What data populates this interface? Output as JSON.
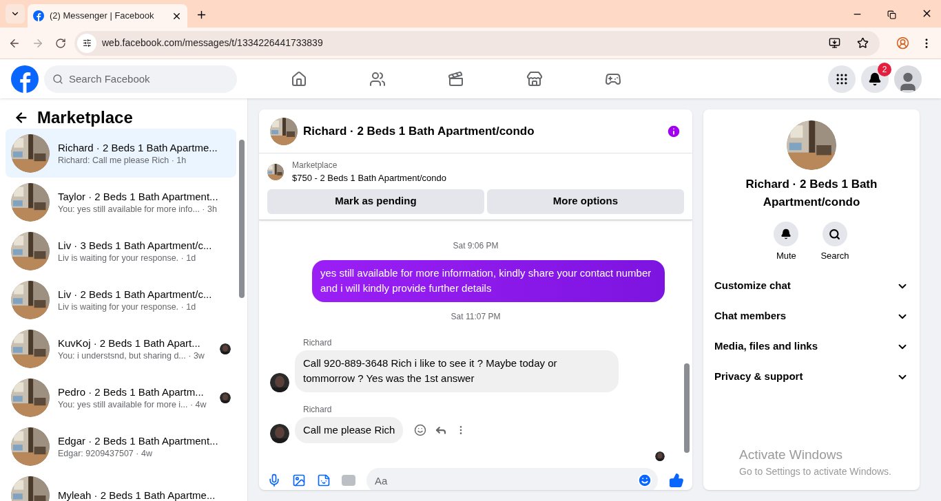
{
  "browser": {
    "tab_title": "(2) Messenger | Facebook",
    "url": "web.facebook.com/messages/t/1334226441733839"
  },
  "header": {
    "search_placeholder": "Search Facebook",
    "notification_count": "2"
  },
  "sidebar": {
    "title": "Marketplace",
    "conversations": [
      {
        "title": "Richard · 2 Beds 1 Bath Apartme...",
        "preview": "Richard: Call me please Rich · 1h",
        "selected": true,
        "seen": false
      },
      {
        "title": "Taylor · 2 Beds 1 Bath Apartment...",
        "preview": "You: yes still available for more info... · 3h",
        "selected": false,
        "seen": false
      },
      {
        "title": "Liv · 3 Beds 1 Bath Apartment/c...",
        "preview": "Liv is waiting for your response. · 1d",
        "selected": false,
        "seen": false
      },
      {
        "title": "Liv · 2 Beds 1 Bath Apartment/c...",
        "preview": "Liv is waiting for your response. · 1d",
        "selected": false,
        "seen": false
      },
      {
        "title": "KuvKoj · 2 Beds 1 Bath Apart...",
        "preview": "You: i understsnd, but sharing d... · 3w",
        "selected": false,
        "seen": true
      },
      {
        "title": "Pedro · 2 Beds 1 Bath Apartm...",
        "preview": "You: yes still available for more i... · 4w",
        "selected": false,
        "seen": true
      },
      {
        "title": "Edgar · 2 Beds 1 Bath Apartment...",
        "preview": "Edgar: 9209437507 · 4w",
        "selected": false,
        "seen": false
      },
      {
        "title": "Myleah · 2 Beds 1 Bath Apartme...",
        "selected": false,
        "seen": false
      }
    ]
  },
  "chat": {
    "title": "Richard · 2 Beds 1 Bath Apartment/condo",
    "listing": {
      "label": "Marketplace",
      "name": "$750 - 2 Beds 1 Bath Apartment/condo"
    },
    "actions": [
      "Mark as pending",
      "More options"
    ],
    "messages": [
      {
        "kind": "time",
        "text": "Sat 9:06 PM"
      },
      {
        "kind": "sent",
        "text": "yes still available for more information, kindly share your contact number and i will kindly provide further details"
      },
      {
        "kind": "time",
        "text": "Sat 11:07 PM"
      },
      {
        "kind": "received",
        "sender": "Richard",
        "text": "Call 920-889-3648  Rich i like to see it ? Maybe today or tommorrow ?  Yes was the 1st answer",
        "hovered": false
      },
      {
        "kind": "received",
        "sender": "Richard",
        "text": "Call me please Rich",
        "hovered": true
      }
    ],
    "composer_placeholder": "Aa"
  },
  "info": {
    "title": "Richard · 2 Beds 1 Bath Apartment/condo",
    "buttons": [
      "Mute",
      "Search"
    ],
    "sections": [
      "Customize chat",
      "Chat members",
      "Media, files and links",
      "Privacy & support"
    ]
  },
  "os_notice": {
    "title": "Activate Windows",
    "text": "Go to Settings to activate Windows."
  }
}
